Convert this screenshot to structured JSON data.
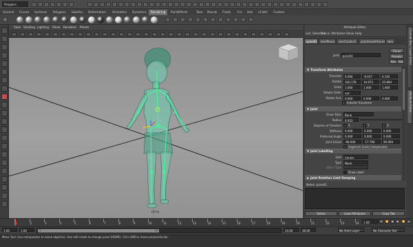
{
  "status_line": {
    "mode": "Polygons"
  },
  "shelf": {
    "tabs": [
      "General",
      "Curves",
      "Surfaces",
      "Polygons",
      "Subdivs",
      "Deformation",
      "Animation",
      "Dynamics",
      "Rendering",
      "PaintEffects",
      "Toon",
      "Muscle",
      "Fluids",
      "Fur",
      "Hair",
      "nCloth",
      "Custom"
    ],
    "active_tab": "Rendering",
    "sphere_colors": [
      "#8a8a8a",
      "#9a9a9a",
      "#6d6d6d",
      "#7a7a7a",
      "#505050",
      "#404040",
      "#b0b0b0",
      "#3a3a3a",
      "#c8c8c8",
      "#2e2e2e",
      "#8f8f8f",
      "#d0d0d0",
      "#6a6a6a",
      "#a5a5a5",
      "#5a5a5a",
      "#bdbdbd"
    ]
  },
  "panel_menu": [
    "View",
    "Shading",
    "Lighting",
    "Show",
    "Renderer",
    "Panels"
  ],
  "viewport": {
    "view_cube_label": "FRONT",
    "camera_label": "persp",
    "skin_color": "#6ecfb0",
    "joint_color": "#3dff9a"
  },
  "attribute_editor": {
    "title": "Attribute Editor",
    "menu": [
      "List",
      "Selected",
      "Focus",
      "Attributes",
      "Show",
      "Help"
    ],
    "tabs": [
      "spine01",
      "bindPose1",
      "skinCluster3",
      "polySmoothFace4",
      "skin"
    ],
    "active_tab": "spine01",
    "node_type_label": "joint:",
    "node_name": "spine01",
    "focus_button": "Focus",
    "presets_button": "Presets",
    "show_button": "Show",
    "hide_button": "Hide",
    "transform_section": "Transform Attributes",
    "transform_rows": [
      {
        "label": "Translate",
        "values": [
          "0.000",
          "-0.037",
          "0.142"
        ]
      },
      {
        "label": "Rotate",
        "values": [
          "100.178",
          "16.972",
          "25.894"
        ]
      },
      {
        "label": "Scale",
        "values": [
          "1.000",
          "1.000",
          "1.000"
        ]
      },
      {
        "label": "Rotate Order",
        "values": [
          "xyz"
        ]
      },
      {
        "label": "Rotate Axis",
        "values": [
          "0.000",
          "0.000",
          "0.000"
        ]
      }
    ],
    "inherits_transform": "Inherits Transform",
    "joint_section": "Joint",
    "draw_style_label": "Draw Style",
    "draw_style_value": "Bone",
    "radius_label": "Radius",
    "radius_value": "0.933",
    "dof_label": "Degrees of Freedom",
    "dof_axes": [
      "X",
      "Y",
      "Z"
    ],
    "stiffness_label": "Stiffness",
    "stiffness_values": [
      "0.000",
      "0.000",
      "0.000"
    ],
    "pref_angle_label": "Preferred Angle",
    "pref_angle_values": [
      "0.000",
      "0.000",
      "0.000"
    ],
    "joint_orient_label": "Joint Orient",
    "joint_orient_values": [
      "-90.000",
      "-17.790",
      "90.000"
    ],
    "segment_scale": "Segment Scale Compensate",
    "labelling_section": "Joint Labelling",
    "side_label": "Side",
    "side_value": "Center",
    "type_label": "Type",
    "type_value": "None",
    "other_type_label": "Other Type",
    "draw_label": "Draw Label",
    "rotation_limit_section": "Joint Rotation Limit Damping",
    "notes_label": "Notes:",
    "notes_node": "spine01",
    "bottom_buttons": [
      "Select",
      "Load Attributes",
      "Copy Tab"
    ]
  },
  "side_tabs": [
    "Channel Box / Layer Editor",
    "Attribute Editor"
  ],
  "time_slider": {
    "ticks": [
      "1",
      "2",
      "3",
      "4",
      "5",
      "6",
      "7",
      "8",
      "9",
      "10",
      "11",
      "12",
      "13",
      "14",
      "15",
      "16",
      "17",
      "18",
      "19",
      "20",
      "21",
      "22",
      "23",
      "24"
    ],
    "current_frame": "1.00"
  },
  "range_slider": {
    "start_time": "1.00",
    "playback_start": "1.00",
    "playback_end": "24.00",
    "end_time": "48.00",
    "range_label": "1",
    "range_end_label": "24",
    "anim_layer": "No Anim Layer",
    "char_set": "No Character Set"
  },
  "help_line": "Move Tool: Use manipulator to move object(s). Use edit mode to change pivot (HOME). Ctrl+LMB to move perpendicular."
}
